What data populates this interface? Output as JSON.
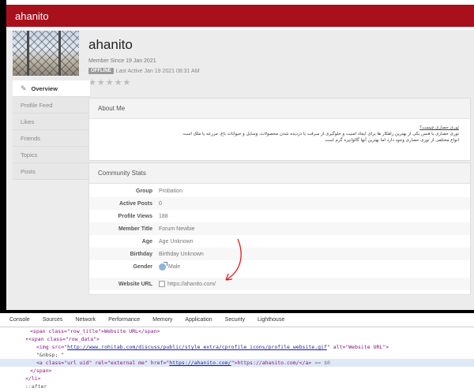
{
  "site": {
    "title": "ahanito"
  },
  "profile": {
    "username": "ahanito",
    "member_since": "Member Since 19 Jan 2021",
    "status_badge": "OFFLINE",
    "last_active": "Last Active Jan 19 2021 08:31 AM",
    "rating_stars": 5
  },
  "nav": {
    "items": [
      {
        "label": "Overview",
        "icon": "pencil-icon"
      },
      {
        "label": "Profile Feed"
      },
      {
        "label": "Likes"
      },
      {
        "label": "Friends"
      },
      {
        "label": "Topics"
      },
      {
        "label": "Posts"
      }
    ]
  },
  "about": {
    "title": "About Me",
    "heading": "توری حصاری چیست؟",
    "line1": "توری حصاری یا فنس یکی از بهترین راهکار ها برای ایجاد امنیت و جلوگیری از سرقت یا دزدیده شدن محصولات، وسایل و حیوانات باغ، مزرعه یا ملک است",
    "line2": "انواع مختلفی از توری حصاری وجود دارد اما بهترین آنها گالوانیزه گرم است"
  },
  "stats": {
    "title": "Community Stats",
    "rows": [
      {
        "label": "Group",
        "value": "Probation"
      },
      {
        "label": "Active Posts",
        "value": "0"
      },
      {
        "label": "Profile Views",
        "value": "188"
      },
      {
        "label": "Member Title",
        "value": "Forum Newbie"
      },
      {
        "label": "Age",
        "value": "Age Unknown"
      },
      {
        "label": "Birthday",
        "value": "Birthday Unknown"
      },
      {
        "label": "Gender",
        "value": "Male",
        "icon": "gender-male-icon"
      },
      {
        "label": "Website URL",
        "value": "https://ahanito.com/",
        "icon": "website-icon"
      }
    ]
  },
  "devtools": {
    "tabs": [
      "Console",
      "Sources",
      "Network",
      "Performance",
      "Memory",
      "Application",
      "Security",
      "Lighthouse"
    ],
    "code": {
      "l1_open": "<span class=\"row_title\">Website URL</span>",
      "l2": "<span class=\"row_data\">",
      "l3_pre": "<img src=\"",
      "l3_url": "http://www.rohitab.com/discuss/public/style_extra/cprofile_icons/profile_website.gif",
      "l3_post": "\" alt=\"Website URL\">",
      "l4": "\"&nbsp; \"",
      "l5_pre": "<a class=\"url uid\" rel=\"external me\" href=\"",
      "l5_url": "https://ahanito.com/",
      "l5_post": "\">https://ahanito.com/</a>",
      "l5_eq": "== $0",
      "l6": "</span>",
      "l7": "</li>",
      "l8": "::after"
    }
  },
  "colors": {
    "brand": "#a8101c"
  }
}
